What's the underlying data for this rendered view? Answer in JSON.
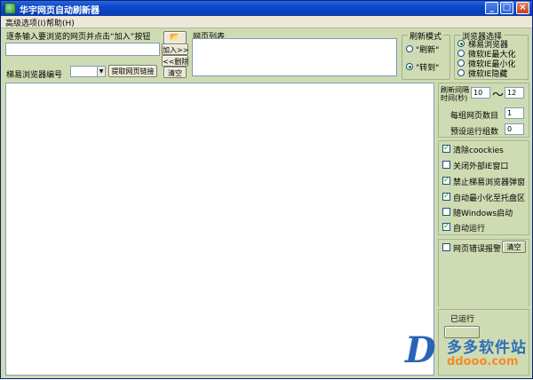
{
  "window": {
    "title": "华宇网页自动刷新器",
    "min_label": "_",
    "max_label": "□",
    "close_label": "×"
  },
  "menu": [
    "高级选项(I)",
    "帮助(H)"
  ],
  "url_input": {
    "prompt": "逐条输入要浏览的网页并点击“加入”按钮",
    "value": "",
    "open_icon_label": "📂",
    "add_label": "加入>>",
    "remove_label": "<<删除",
    "clear_label": "清空"
  },
  "browser_id": {
    "label": "梯易浏览器编号",
    "value": "",
    "fetch_label": "提取网页链接"
  },
  "url_list": {
    "title": "网页列表",
    "items": []
  },
  "refresh_mode": {
    "title": "刷新模式",
    "options": [
      {
        "label": "\"刷新\"",
        "checked": false
      },
      {
        "label": "\"转到\"",
        "checked": true
      }
    ]
  },
  "browser_select": {
    "title": "浏览器选择",
    "options": [
      {
        "label": "梯易浏览器",
        "checked": true
      },
      {
        "label": "微软IE最大化",
        "checked": false
      },
      {
        "label": "微软IE最小化",
        "checked": false
      },
      {
        "label": "微软IE隐藏",
        "checked": false
      }
    ]
  },
  "settings": {
    "interval_label": "刷新间隔\n时间(秒)",
    "interval_min": "10",
    "interval_sep": "〜",
    "interval_max": "12",
    "group_pages_label": "每组网页数目",
    "group_pages": "1",
    "run_groups_label": "预设运行组数",
    "run_groups": "0"
  },
  "options": [
    {
      "label": "清除coockies",
      "checked": true
    },
    {
      "label": "关闭外部IE窗口",
      "checked": false
    },
    {
      "label": "禁止梯易浏览器弹窗",
      "checked": true
    },
    {
      "label": "自动最小化至托盘区",
      "checked": true
    },
    {
      "label": "随Windows启动",
      "checked": false
    },
    {
      "label": "自动运行",
      "checked": true
    }
  ],
  "error_alarm": {
    "label": "网页错误报警",
    "checked": false,
    "clear_label": "清空"
  },
  "status": {
    "ran_label": "已运行"
  },
  "watermark": {
    "cn": "多多软件站",
    "url": "ddooo.com",
    "logo_letter": "D"
  }
}
